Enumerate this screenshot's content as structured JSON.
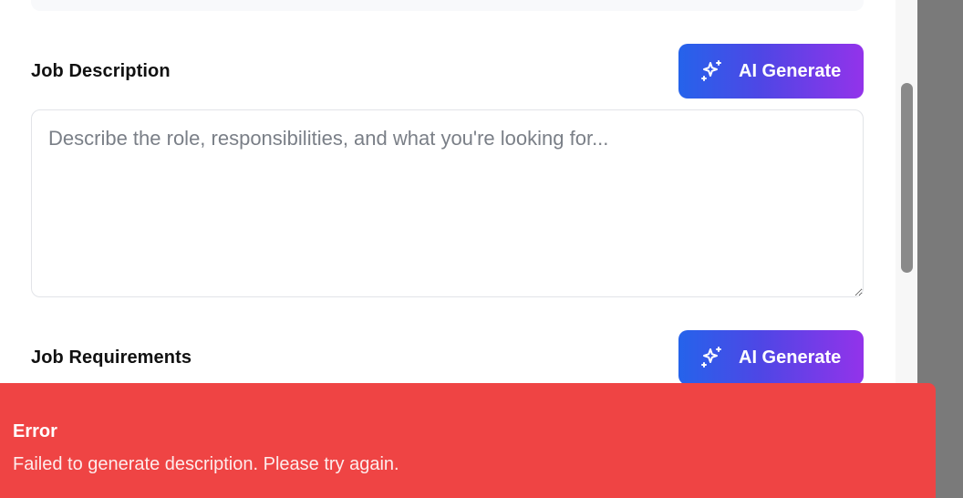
{
  "form": {
    "description": {
      "label": "Job Description",
      "placeholder": "Describe the role, responsibilities, and what you're looking for...",
      "value": ""
    },
    "requirements": {
      "label": "Job Requirements"
    },
    "ai_button_label": "AI Generate",
    "ai_button_icon": "sparkles-icon",
    "accent_gradient": [
      "#2563eb",
      "#9333ea"
    ]
  },
  "toast": {
    "title": "Error",
    "message": "Failed to generate description. Please try again.",
    "color": "#ef4444"
  }
}
